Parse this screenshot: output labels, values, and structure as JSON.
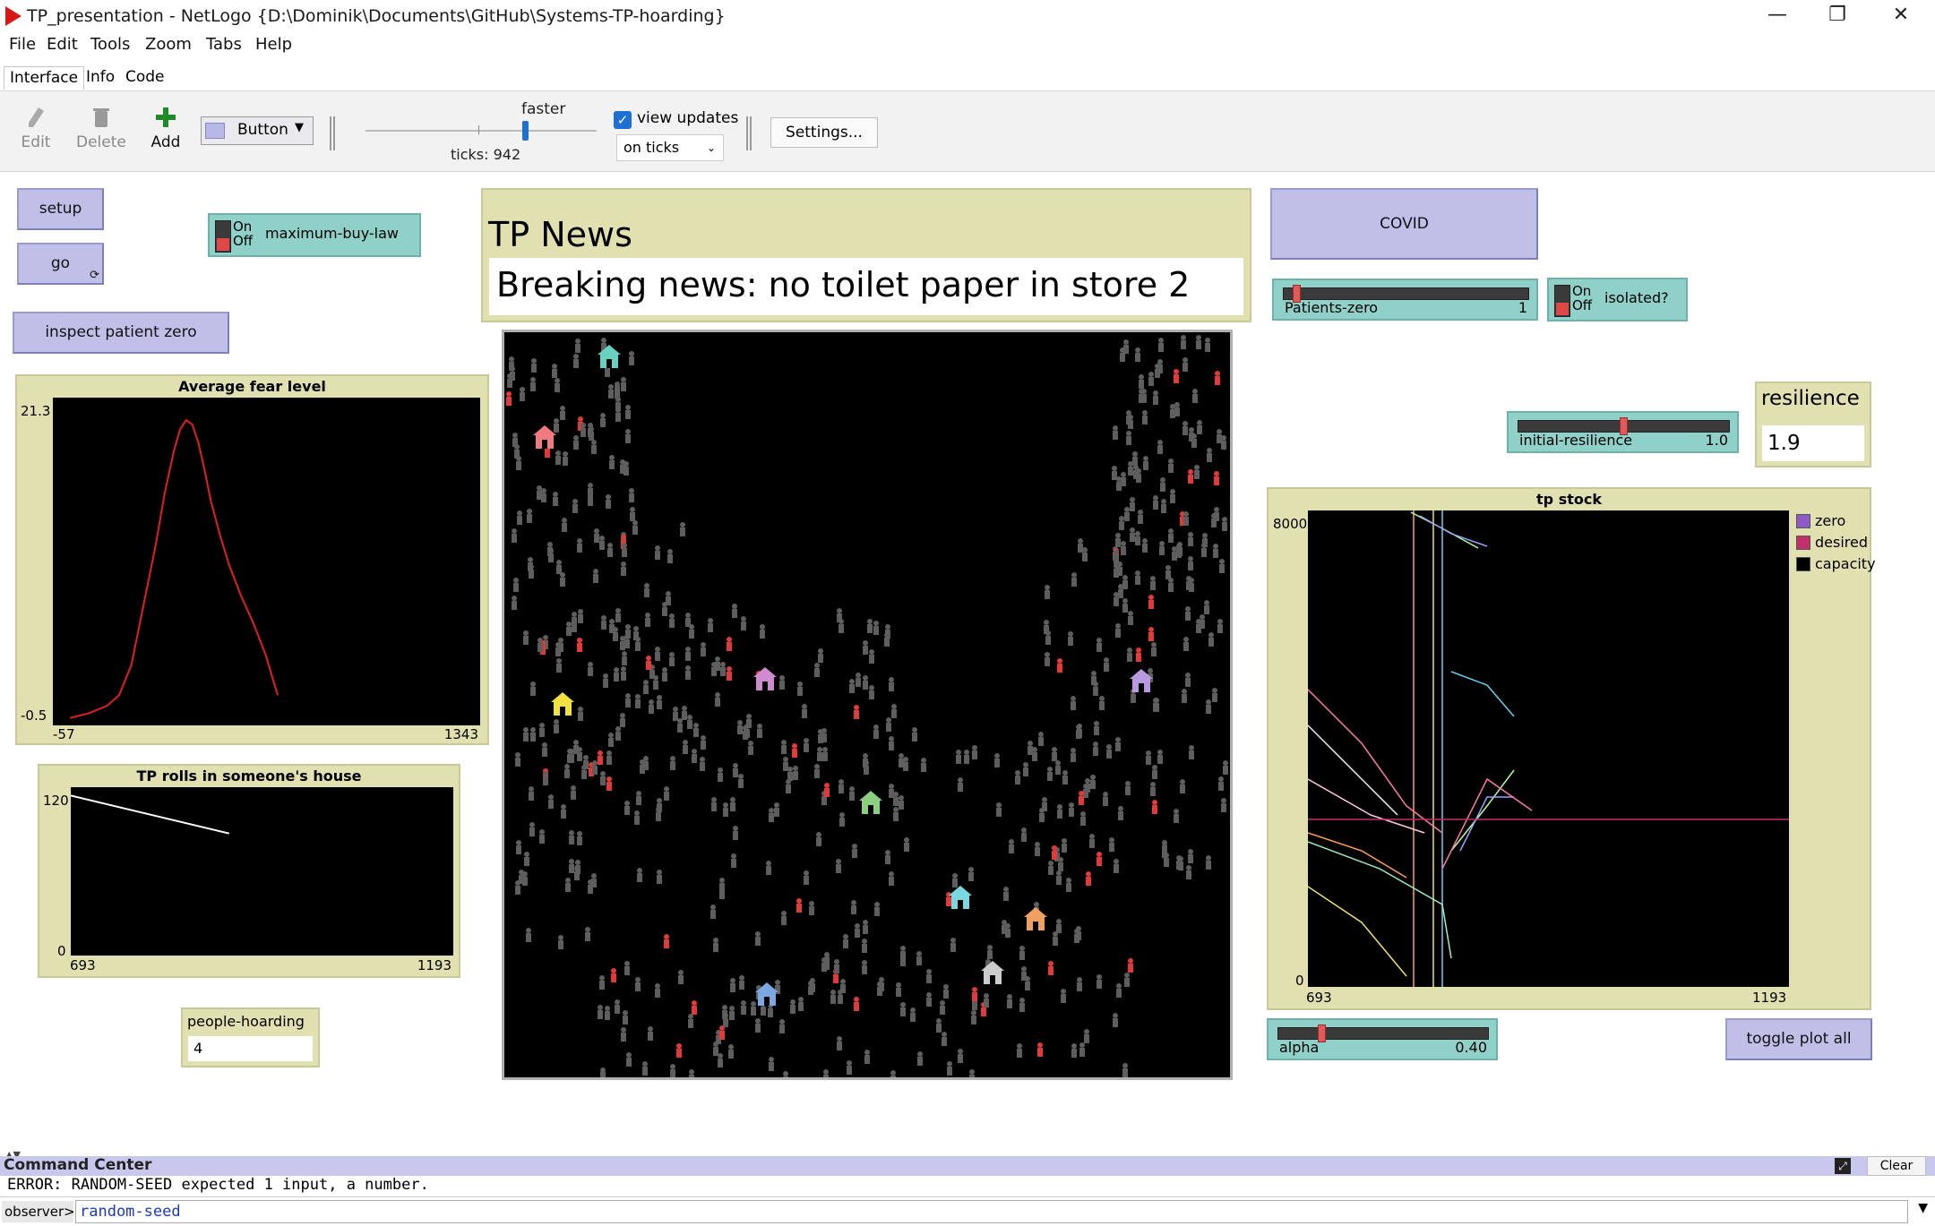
{
  "window": {
    "title": "TP_presentation - NetLogo {D:\\Dominik\\Documents\\GitHub\\Systems-TP-hoarding}",
    "minimize": "—",
    "restore": "❐",
    "close": "✕"
  },
  "menu": [
    "File",
    "Edit",
    "Tools",
    "Zoom",
    "Tabs",
    "Help"
  ],
  "tabs": [
    "Interface",
    "Info",
    "Code"
  ],
  "toolbar": {
    "edit": "Edit",
    "delete": "Delete",
    "add": "Add",
    "widget_type": "Button",
    "speed_label": "faster",
    "ticks": "ticks: 942",
    "view_updates": "view updates",
    "update_mode": "on ticks",
    "settings": "Settings..."
  },
  "buttons": {
    "setup": "setup",
    "go": "go",
    "inspect": "inspect patient zero",
    "covid": "COVID",
    "toggle_plot": "toggle plot all"
  },
  "switches": {
    "maximum_buy_law": {
      "label": "maximum-buy-law",
      "on": "On",
      "off": "Off"
    },
    "isolated": {
      "label": "isolated?",
      "on": "On",
      "off": "Off"
    }
  },
  "sliders": {
    "patients_zero": {
      "label": "Patients-zero",
      "value": "1",
      "fraction": 0.04
    },
    "initial_resilience": {
      "label": "initial-resilience",
      "value": "1.0",
      "fraction": 0.5
    },
    "alpha": {
      "label": "alpha",
      "value": "0.40",
      "fraction": 0.2
    }
  },
  "monitors": {
    "news": {
      "label": "TP News",
      "value": "Breaking news: no toilet paper in store 2"
    },
    "resilience": {
      "label": "resilience",
      "value": "1.9"
    },
    "people_hoarding": {
      "label": "people-hoarding",
      "value": "4"
    }
  },
  "plots": {
    "fear": {
      "title": "Average fear level",
      "ymax": "21.3",
      "ymin": "-0.5",
      "xmin": "-57",
      "xmax": "1343"
    },
    "tp_rolls": {
      "title": "TP rolls in someone's house",
      "ymax": "120",
      "ymin": "0",
      "xmin": "693",
      "xmax": "1193"
    },
    "tp_stock": {
      "title": "tp stock",
      "ymax": "8000",
      "ymin": "0",
      "xmin": "693",
      "xmax": "1193",
      "legend": [
        {
          "name": "zero",
          "color": "#8e5ac8"
        },
        {
          "name": "desired",
          "color": "#c0306a"
        },
        {
          "name": "capacity",
          "color": "#000000"
        }
      ]
    }
  },
  "chart_data": [
    {
      "type": "line",
      "title": "Average fear level",
      "xlim": [
        -57,
        1343
      ],
      "ylim": [
        -0.5,
        21.3
      ],
      "series": [
        {
          "color": "#e02020",
          "x": [
            0,
            60,
            120,
            160,
            200,
            240,
            280,
            310,
            340,
            360,
            380,
            400,
            420,
            440,
            460,
            490,
            520,
            560,
            600,
            640,
            680
          ],
          "values": [
            0,
            0.3,
            0.8,
            1.5,
            3.5,
            7.5,
            11.5,
            15,
            17.8,
            19.2,
            19.8,
            19.5,
            18.3,
            16.5,
            14.5,
            12.2,
            10.2,
            8.1,
            6.3,
            4.2,
            1.5
          ]
        }
      ]
    },
    {
      "type": "line",
      "title": "TP rolls in someone's house",
      "xlim": [
        693,
        1193
      ],
      "ylim": [
        0,
        120
      ],
      "series": [
        {
          "color": "#ffffff",
          "x": [
            693,
            900
          ],
          "values": [
            114,
            87
          ]
        }
      ]
    }
  ],
  "command_center": {
    "title": "Command Center",
    "clear": "Clear",
    "output": "ERROR: RANDOM-SEED expected 1 input, a number.",
    "context": "observer>",
    "input": "random-seed"
  }
}
